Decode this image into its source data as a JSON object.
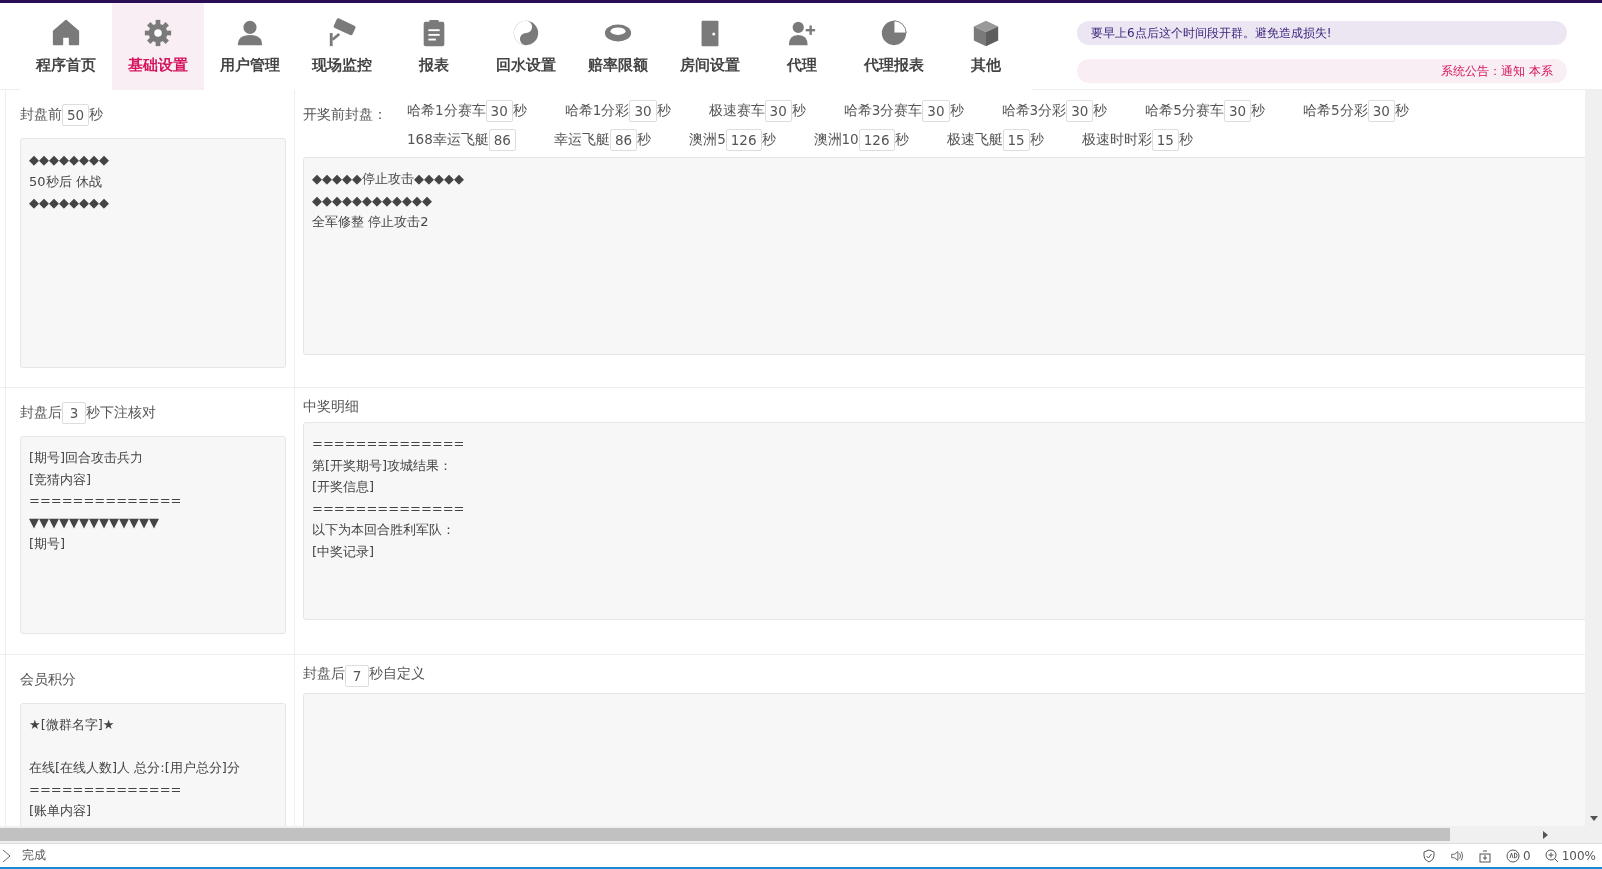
{
  "nav": [
    {
      "label": "程序首页",
      "selected": false
    },
    {
      "label": "基础设置",
      "selected": true
    },
    {
      "label": "用户管理",
      "selected": false
    },
    {
      "label": "现场监控",
      "selected": false
    },
    {
      "label": "报表",
      "selected": false
    },
    {
      "label": "回水设置",
      "selected": false
    },
    {
      "label": "赔率限额",
      "selected": false
    },
    {
      "label": "房间设置",
      "selected": false
    },
    {
      "label": "代理",
      "selected": false
    },
    {
      "label": "代理报表",
      "selected": false
    },
    {
      "label": "其他",
      "selected": false
    }
  ],
  "notices": [
    {
      "kind": "marquee",
      "text": "要早上6点后这个时间段开群。避免造成损失!"
    },
    {
      "kind": "announcement",
      "text": "系统公告：通知 本系"
    }
  ],
  "rows": [
    {
      "left": {
        "label": [
          {
            "kind": "text",
            "text": "封盘前"
          },
          {
            "kind": "input",
            "value": "50"
          },
          {
            "kind": "text",
            "text": "秒"
          }
        ],
        "text": "◆◆◆◆◆◆◆◆\n50秒后 休战\n◆◆◆◆◆◆◆◆"
      },
      "right": {
        "label": [
          {
            "kind": "text",
            "text": "开奖前封盘："
          }
        ],
        "lotteries": [
          {
            "name": "哈希1分赛车",
            "value": "30",
            "unit": "秒"
          },
          {
            "name": "哈希1分彩",
            "value": "30",
            "unit": "秒"
          },
          {
            "name": "极速赛车",
            "value": "30",
            "unit": "秒"
          },
          {
            "name": "哈希3分赛车",
            "value": "30",
            "unit": "秒"
          },
          {
            "name": "哈希3分彩",
            "value": "30",
            "unit": "秒"
          },
          {
            "name": "哈希5分赛车",
            "value": "30",
            "unit": "秒"
          },
          {
            "name": "哈希5分彩",
            "value": "30",
            "unit": "秒"
          },
          {
            "name": "168幸运飞艇",
            "value": "86"
          },
          {
            "name": "幸运飞艇",
            "value": "86",
            "unit": "秒"
          },
          {
            "name": "澳洲5",
            "value": "126",
            "unit": "秒"
          },
          {
            "name": "澳洲10",
            "value": "126",
            "unit": "秒"
          },
          {
            "name": "极速飞艇",
            "value": "15",
            "unit": "秒"
          },
          {
            "name": "极速时时彩",
            "value": "15",
            "unit": "秒"
          }
        ],
        "text": "◆◆◆◆◆停止攻击◆◆◆◆◆\n◆◆◆◆◆◆◆◆◆◆◆◆\n全军修整  停止攻击2"
      }
    },
    {
      "left": {
        "label": [
          {
            "kind": "text",
            "text": "封盘后"
          },
          {
            "kind": "input",
            "value": "3"
          },
          {
            "kind": "text",
            "text": "秒下注核对"
          }
        ],
        "text": "[期号]回合攻击兵力\n[竞猜内容]\n==============\n▼▼▼▼▼▼▼▼▼▼▼▼▼\n[期号]"
      },
      "right": {
        "label": [
          {
            "kind": "text",
            "text": "中奖明细"
          }
        ],
        "text": "==============\n第[开奖期号]攻城结果：\n [开奖信息]\n==============\n以下为本回合胜利军队：\n[中奖记录]"
      }
    },
    {
      "left": {
        "label": [
          {
            "kind": "text",
            "text": "会员积分"
          }
        ],
        "text": "★[微群名字]★\n\n在线[在线人数]人  总分:[用户总分]分\n==============\n[账单内容]"
      },
      "right": {
        "label": [
          {
            "kind": "text",
            "text": "封盘后"
          },
          {
            "kind": "input",
            "value": "7"
          },
          {
            "kind": "text",
            "text": "秒自定义"
          }
        ]
      }
    }
  ],
  "status": {
    "text": "完成",
    "count": "0",
    "zoom": "100%"
  }
}
